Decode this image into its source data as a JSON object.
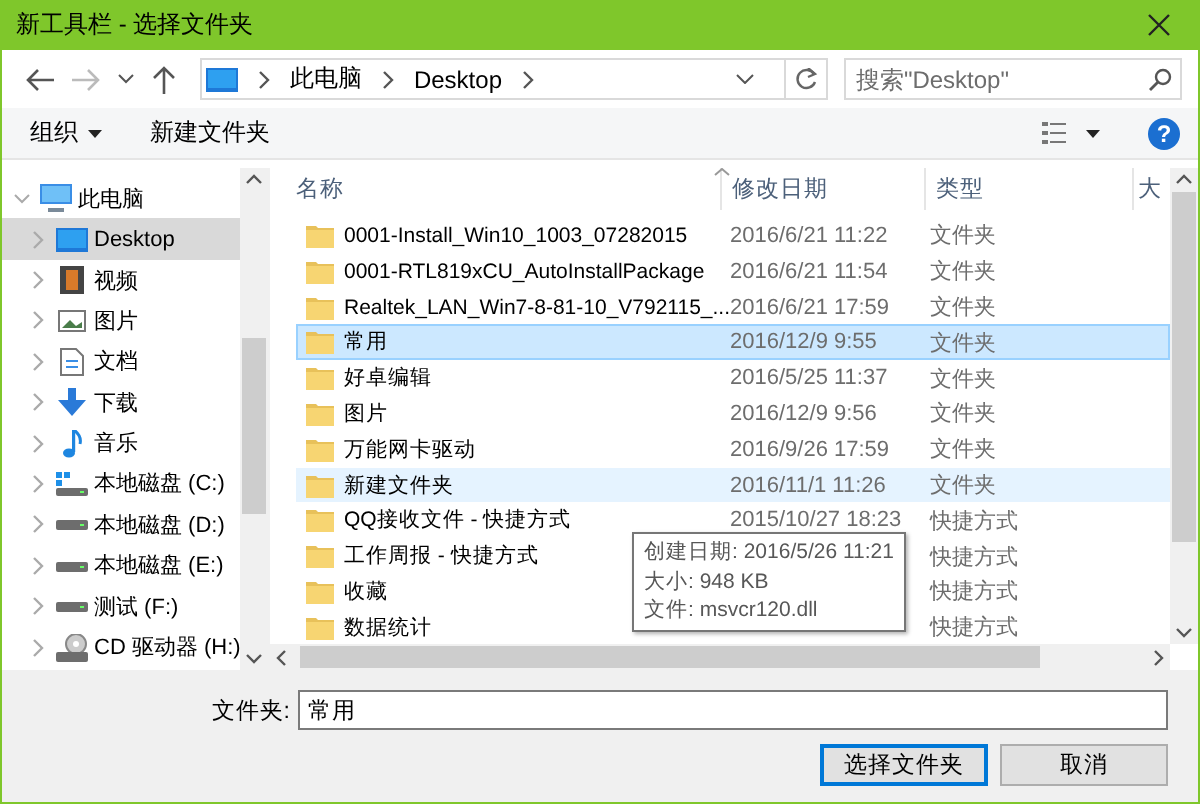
{
  "window": {
    "title": "新工具栏 - 选择文件夹"
  },
  "navigation": {
    "breadcrumb": [
      "此电脑",
      "Desktop"
    ],
    "search": {
      "placeholder": "搜索\"Desktop\""
    }
  },
  "toolbar": {
    "organize": "组织",
    "new_folder": "新建文件夹",
    "help": "?"
  },
  "sidebar": {
    "items": [
      {
        "label": "此电脑",
        "kind": "pc",
        "expanded": true,
        "selected": false,
        "children": [
          {
            "label": "Desktop",
            "kind": "desktop",
            "expanded": false,
            "selected": true
          },
          {
            "label": "视频",
            "kind": "video",
            "expanded": false,
            "selected": false
          },
          {
            "label": "图片",
            "kind": "picture",
            "expanded": false,
            "selected": false
          },
          {
            "label": "文档",
            "kind": "document",
            "expanded": false,
            "selected": false
          },
          {
            "label": "下载",
            "kind": "download",
            "expanded": false,
            "selected": false
          },
          {
            "label": "音乐",
            "kind": "music",
            "expanded": false,
            "selected": false
          },
          {
            "label": "本地磁盘 (C:)",
            "kind": "system-drive",
            "expanded": false,
            "selected": false
          },
          {
            "label": "本地磁盘 (D:)",
            "kind": "drive",
            "expanded": false,
            "selected": false
          },
          {
            "label": "本地磁盘 (E:)",
            "kind": "drive",
            "expanded": false,
            "selected": false
          },
          {
            "label": "测试 (F:)",
            "kind": "drive",
            "expanded": false,
            "selected": false
          },
          {
            "label": "CD 驱动器 (H:)",
            "kind": "cd",
            "expanded": false,
            "selected": false
          }
        ]
      }
    ]
  },
  "table": {
    "columns": [
      "名称",
      "修改日期",
      "类型",
      "大"
    ],
    "rows": [
      {
        "name": "0001-Install_Win10_1003_07282015",
        "date": "2016/6/21 11:22",
        "type": "文件夹",
        "selected": false,
        "hovered": false
      },
      {
        "name": "0001-RTL819xCU_AutoInstallPackage",
        "date": "2016/6/21 11:54",
        "type": "文件夹",
        "selected": false,
        "hovered": false
      },
      {
        "name": "Realtek_LAN_Win7-8-81-10_V792115_...",
        "date": "2016/6/21 17:59",
        "type": "文件夹",
        "selected": false,
        "hovered": false
      },
      {
        "name": "常用",
        "date": "2016/12/9 9:55",
        "type": "文件夹",
        "selected": true,
        "hovered": false
      },
      {
        "name": "好卓编辑",
        "date": "2016/5/25 11:37",
        "type": "文件夹",
        "selected": false,
        "hovered": false
      },
      {
        "name": "图片",
        "date": "2016/12/9 9:56",
        "type": "文件夹",
        "selected": false,
        "hovered": false
      },
      {
        "name": "万能网卡驱动",
        "date": "2016/9/26 17:59",
        "type": "文件夹",
        "selected": false,
        "hovered": false
      },
      {
        "name": "新建文件夹",
        "date": "2016/11/1 11:26",
        "type": "文件夹",
        "selected": false,
        "hovered": true
      },
      {
        "name": "QQ接收文件 - 快捷方式",
        "date": "2015/10/27 18:23",
        "type": "快捷方式",
        "selected": false,
        "hovered": false
      },
      {
        "name": "工作周报 - 快捷方式",
        "type": "快捷方式",
        "selected": false,
        "hovered": false
      },
      {
        "name": "收藏",
        "type": "快捷方式",
        "selected": false,
        "hovered": false
      },
      {
        "name": "数据统计",
        "type": "快捷方式",
        "selected": false,
        "hovered": false
      }
    ],
    "tooltip": [
      "创建日期: 2016/5/26 11:21",
      "大小: 948 KB",
      "文件: msvcr120.dll"
    ]
  },
  "footer": {
    "folder_label": "文件夹:",
    "folder_value": "常用",
    "buttons": [
      {
        "label": "选择文件夹",
        "focused": true
      },
      {
        "label": "取消",
        "focused": false
      }
    ]
  }
}
